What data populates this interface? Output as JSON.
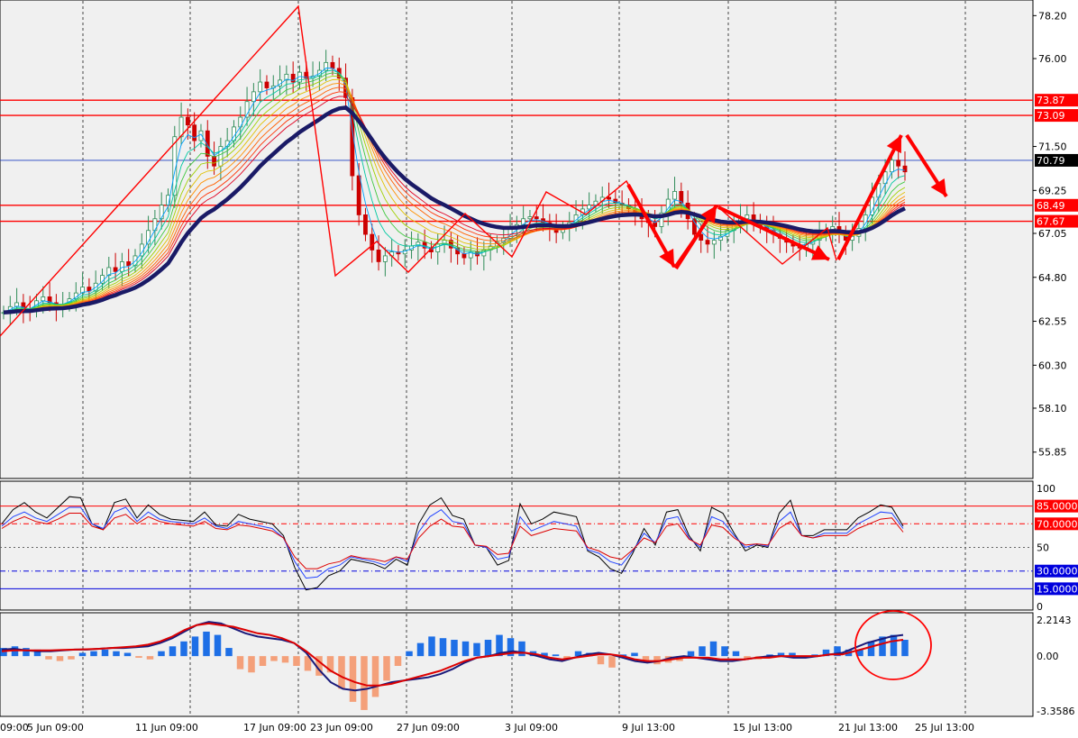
{
  "colors": {
    "bg": "#f0f0f0",
    "grid": "#6e6e6e",
    "bull": "#2e8b57",
    "bear": "#cc0000",
    "red": "#ff0000",
    "navy": "#1a1a66",
    "blueline": "#3355ff",
    "hist_pos": "#1e6fe6",
    "hist_neg": "#f4a07a",
    "priceHL": "#1f3fbf",
    "label_red": "#ff0000",
    "label_black": "#000000"
  },
  "chart_data": [
    {
      "type": "candlestick",
      "panel": "main",
      "x_ticks": [
        "09:00",
        "5 Jun 09:00",
        "11 Jun 09:00",
        "17 Jun 09:00",
        "23 Jun 09:00",
        "27 Jun 09:00",
        "3 Jul 09:00",
        "9 Jul 13:00",
        "15 Jul 13:00",
        "21 Jul 13:00",
        "25 Jul 13:00"
      ],
      "y_ticks": [
        78.2,
        76.0,
        71.5,
        69.25,
        67.05,
        64.8,
        62.55,
        60.3,
        58.1,
        55.85
      ],
      "ylim": [
        54.5,
        79.0
      ],
      "horizontal_levels": [
        {
          "value": 73.87,
          "label": "73.87",
          "style": "red"
        },
        {
          "value": 73.09,
          "label": "73.09",
          "style": "red"
        },
        {
          "value": 70.79,
          "label": "70.79",
          "style": "current"
        },
        {
          "value": 68.49,
          "label": "68.49",
          "style": "red"
        },
        {
          "value": 67.67,
          "label": "67.67",
          "style": "red"
        }
      ],
      "closes": [
        63.0,
        63.3,
        63.5,
        63.2,
        63.1,
        63.6,
        63.8,
        63.5,
        63.3,
        63.4,
        63.7,
        64.0,
        64.3,
        64.1,
        64.5,
        64.9,
        65.3,
        65.1,
        65.6,
        65.4,
        65.9,
        66.5,
        67.2,
        67.8,
        68.5,
        69.0,
        72.0,
        73.0,
        72.6,
        71.8,
        72.3,
        71.0,
        70.5,
        71.5,
        71.8,
        72.5,
        73.0,
        73.8,
        74.3,
        74.8,
        74.5,
        74.6,
        74.9,
        75.2,
        74.8,
        75.3,
        75.0,
        75.1,
        75.4,
        75.8,
        75.5,
        75.0,
        74.0,
        70.0,
        68.0,
        67.0,
        66.2,
        65.6,
        65.9,
        66.1,
        66.0,
        66.2,
        66.4,
        66.6,
        66.3,
        66.1,
        66.5,
        66.7,
        66.3,
        66.0,
        65.8,
        66.1,
        65.9,
        66.2,
        66.4,
        66.6,
        66.8,
        67.3,
        67.5,
        67.8,
        67.9,
        67.8,
        67.6,
        67.4,
        67.1,
        67.3,
        67.6,
        68.0,
        68.3,
        68.5,
        68.7,
        68.9,
        68.8,
        68.6,
        68.5,
        68.3,
        68.1,
        67.8,
        67.6,
        67.4,
        68.1,
        68.8,
        69.2,
        68.6,
        67.8,
        67.0,
        66.7,
        66.5,
        66.7,
        66.9,
        67.2,
        67.5,
        67.8,
        68.0,
        67.7,
        67.4,
        67.2,
        67.0,
        66.8,
        66.6,
        66.4,
        66.3,
        66.5,
        66.7,
        67.0,
        67.2,
        67.4,
        67.0,
        66.7,
        66.9,
        67.3,
        68.0,
        68.9,
        69.6,
        70.2,
        70.8,
        70.5,
        70.2
      ],
      "candle_range": "estimated from visible price path"
    },
    {
      "type": "line",
      "panel": "oscillator",
      "title": "",
      "y_ticks": [
        100,
        50,
        0
      ],
      "levels": [
        {
          "value": 85,
          "label": "85.0000",
          "style": "red"
        },
        {
          "value": 70,
          "label": "70.0000",
          "style": "red-dashdot"
        },
        {
          "value": 30,
          "label": "30.0000",
          "style": "blue-dashdot"
        },
        {
          "value": 15,
          "label": "15.0000",
          "style": "blue"
        }
      ],
      "ylim": [
        0,
        100
      ],
      "series": [
        {
          "color": "#000000",
          "values": [
            70,
            82,
            88,
            80,
            75,
            84,
            93,
            92,
            70,
            65,
            88,
            91,
            75,
            86,
            78,
            74,
            73,
            72,
            80,
            69,
            68,
            78,
            74,
            72,
            70,
            60,
            33,
            14,
            16,
            26,
            30,
            40,
            38,
            36,
            32,
            40,
            35,
            70,
            86,
            92,
            77,
            74,
            52,
            50,
            35,
            39,
            87,
            70,
            74,
            80,
            78,
            76,
            47,
            42,
            32,
            28,
            45,
            66,
            52,
            80,
            82,
            60,
            47,
            84,
            79,
            62,
            47,
            52,
            50,
            79,
            90,
            60,
            60,
            65,
            65,
            65,
            75,
            80,
            86,
            84,
            68
          ]
        },
        {
          "color": "#2244ff",
          "values": [
            68,
            76,
            80,
            75,
            72,
            78,
            84,
            84,
            70,
            66,
            80,
            84,
            72,
            80,
            74,
            72,
            71,
            70,
            75,
            68,
            66,
            72,
            70,
            68,
            66,
            58,
            38,
            24,
            25,
            32,
            35,
            42,
            40,
            38,
            35,
            42,
            38,
            63,
            76,
            82,
            72,
            70,
            52,
            50,
            40,
            42,
            76,
            64,
            68,
            72,
            70,
            68,
            48,
            45,
            38,
            35,
            47,
            62,
            54,
            74,
            76,
            58,
            50,
            76,
            72,
            60,
            50,
            53,
            51,
            72,
            80,
            60,
            58,
            62,
            62,
            62,
            70,
            75,
            80,
            79,
            66
          ]
        },
        {
          "color": "#dd0000",
          "values": [
            66,
            72,
            76,
            72,
            70,
            74,
            79,
            79,
            68,
            65,
            75,
            78,
            70,
            76,
            72,
            70,
            69,
            68,
            72,
            66,
            65,
            69,
            68,
            66,
            64,
            58,
            42,
            32,
            32,
            36,
            38,
            43,
            41,
            40,
            38,
            42,
            40,
            58,
            68,
            74,
            68,
            67,
            52,
            51,
            44,
            45,
            68,
            60,
            63,
            66,
            65,
            64,
            50,
            47,
            42,
            40,
            48,
            58,
            54,
            68,
            70,
            57,
            52,
            69,
            67,
            58,
            52,
            53,
            52,
            66,
            72,
            60,
            58,
            60,
            60,
            60,
            66,
            70,
            74,
            75,
            63
          ]
        }
      ]
    },
    {
      "type": "bar",
      "panel": "macd",
      "title": "",
      "y_ticks": [
        2.2143,
        0.0,
        -3.3586
      ],
      "ylim": [
        -3.3586,
        2.2143
      ],
      "histogram": [
        0.5,
        0.6,
        0.5,
        0.4,
        -0.2,
        -0.3,
        -0.2,
        0.2,
        0.3,
        0.4,
        0.3,
        0.2,
        -0.1,
        -0.2,
        0.3,
        0.6,
        0.9,
        1.2,
        1.5,
        1.3,
        0.5,
        -0.8,
        -1.0,
        -0.6,
        -0.3,
        -0.4,
        -0.6,
        -0.9,
        -1.2,
        -1.0,
        -2.0,
        -2.8,
        -3.3,
        -2.5,
        -1.5,
        -0.6,
        0.3,
        0.8,
        1.2,
        1.1,
        1.0,
        0.9,
        0.8,
        1.0,
        1.3,
        1.1,
        0.9,
        0.3,
        0.2,
        0.1,
        -0.2,
        0.3,
        0.2,
        -0.5,
        -0.7,
        0.1,
        0.2,
        -0.3,
        -0.5,
        -0.4,
        -0.3,
        0.3,
        0.6,
        0.9,
        0.6,
        0.3,
        -0.2,
        -0.2,
        0.1,
        0.2,
        0.2,
        -0.1,
        0.1,
        0.4,
        0.6,
        0.4,
        0.4,
        0.9,
        1.2,
        1.3,
        1.0
      ],
      "signal_lines": [
        {
          "color": "#1a1a7a",
          "values": [
            0.4,
            0.45,
            0.35,
            0.3,
            0.3,
            0.35,
            0.4,
            0.4,
            0.45,
            0.5,
            0.5,
            0.55,
            0.6,
            0.8,
            1.1,
            1.5,
            1.9,
            2.1,
            2.0,
            1.7,
            1.4,
            1.2,
            1.1,
            1.0,
            0.8,
            0.2,
            -0.8,
            -1.6,
            -2.0,
            -2.1,
            -2.0,
            -1.8,
            -1.6,
            -1.5,
            -1.4,
            -1.3,
            -1.1,
            -0.8,
            -0.4,
            -0.1,
            0.0,
            0.2,
            0.3,
            0.2,
            0.0,
            -0.2,
            -0.3,
            -0.1,
            0.1,
            0.2,
            0.1,
            -0.1,
            -0.3,
            -0.4,
            -0.3,
            -0.1,
            0.0,
            -0.1,
            -0.2,
            -0.3,
            -0.3,
            -0.2,
            -0.1,
            0.0,
            0.0,
            -0.1,
            -0.1,
            0.0,
            0.1,
            0.2,
            0.5,
            0.8,
            1.0,
            1.2,
            1.3
          ]
        },
        {
          "color": "#dd0000",
          "values": [
            0.3,
            0.35,
            0.35,
            0.35,
            0.35,
            0.38,
            0.4,
            0.42,
            0.45,
            0.5,
            0.55,
            0.6,
            0.7,
            0.9,
            1.2,
            1.6,
            1.9,
            2.0,
            1.9,
            1.8,
            1.6,
            1.4,
            1.3,
            1.1,
            0.8,
            0.3,
            -0.3,
            -0.9,
            -1.3,
            -1.6,
            -1.8,
            -1.8,
            -1.7,
            -1.5,
            -1.3,
            -1.1,
            -0.9,
            -0.6,
            -0.3,
            -0.1,
            0.0,
            0.1,
            0.2,
            0.2,
            0.1,
            -0.1,
            -0.2,
            -0.1,
            0.0,
            0.1,
            0.1,
            0.0,
            -0.2,
            -0.3,
            -0.3,
            -0.2,
            -0.1,
            -0.1,
            -0.1,
            -0.2,
            -0.2,
            -0.2,
            -0.1,
            -0.1,
            0.0,
            0.0,
            0.0,
            0.0,
            0.1,
            0.1,
            0.3,
            0.5,
            0.7,
            0.9,
            1.0
          ]
        }
      ]
    }
  ]
}
